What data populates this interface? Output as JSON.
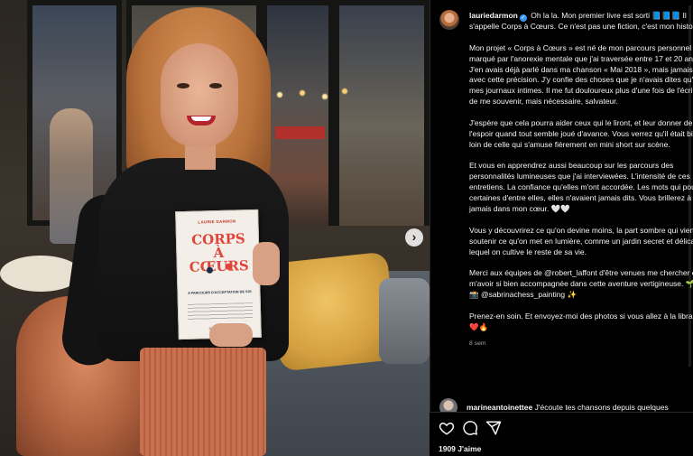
{
  "post": {
    "username": "lauriedarmon",
    "caption_paragraphs": [
      "Oh la la. Mon premier livre est sorti 📘📘📘 Il s'appelle Corps à Cœurs. Ce n'est pas une fiction, c'est mon histoire.",
      "Mon projet « Corps à Cœurs » est né de mon parcours personnel marqué par l'anorexie mentale que j'ai traversée entre 17 et 20 ans. J'en avais déjà parlé dans ma chanson « Mai 2018 », mais jamais avec cette précision. J'y confie des choses que je n'avais dites qu'à mes journaux intimes. Il me fut douloureux plus d'une fois de l'écrire et de me souvenir, mais nécessaire, salvateur.",
      "J'espère que cela pourra aider ceux qui le liront, et leur donner de l'espoir quand tout semble joué d'avance. Vous verrez qu'il était bien loin de celle qui s'amuse fièrement en mini short sur scène.",
      "Et vous en apprendrez aussi beaucoup sur les parcours des personnalités lumineuses que j'ai interviewées. L'intensité de ces entretiens. La confiance qu'elles m'ont accordée. Les mots qui pour certaines d'entre elles, elles n'avaient jamais dits. Vous brillerez à jamais dans mon cœur. 🤍🤍",
      "Vous y découvrirez ce qu'on devine moins, la part sombre qui vient soutenir ce qu'on met en lumière, comme un jardin secret et délicat sur lequel on cultive le reste de sa vie.",
      "Merci aux équipes de @robert_laffont d'être venues me chercher et de m'avoir si bien accompagnée dans cette aventure vertigineuse. 🌱",
      "📸 @sabrinachess_painting ✨",
      "Prenez-en soin. Et envoyez-moi des photos si vous allez à la librairie ❤️🔥"
    ],
    "time_ago": "8 sem",
    "comment": {
      "username": "marineantoinettee",
      "text": "J'écoute tes chansons depuis quelques"
    },
    "likes": "1909 J'aime"
  },
  "book": {
    "author": "LAURIE DARMON",
    "title_line1": "CORPS",
    "title_line2": "À",
    "title_line3": "CŒURS",
    "subtitle": "8 PARCOURS D'ACCEPTATION DE SOI",
    "publisher": "Robert Laffont"
  },
  "icons": {
    "like": "heart-icon",
    "comment": "comment-icon",
    "share": "share-icon",
    "next": "chevron-right-icon"
  },
  "colors": {
    "background": "#000000",
    "text": "#f5f5f5",
    "secondary_text": "#a8a8a8",
    "verified": "#3897f0"
  }
}
